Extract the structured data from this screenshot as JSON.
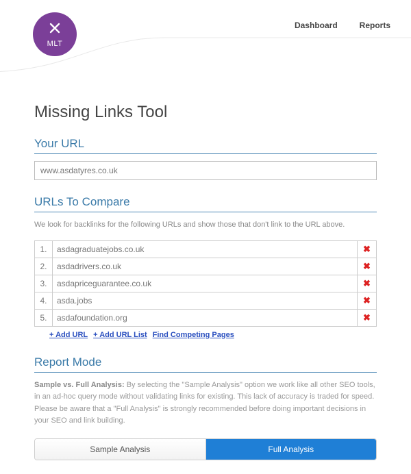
{
  "logo": {
    "text": "MLT"
  },
  "nav": {
    "dashboard": "Dashboard",
    "reports": "Reports"
  },
  "page": {
    "title": "Missing Links Tool"
  },
  "your_url": {
    "heading": "Your URL",
    "value": "www.asdatyres.co.uk"
  },
  "compare": {
    "heading": "URLs To Compare",
    "desc": "We look for backlinks for the following URLs and show those that don't link to the URL above.",
    "items": [
      {
        "n": "1.",
        "v": "asdagraduatejobs.co.uk"
      },
      {
        "n": "2.",
        "v": "asdadrivers.co.uk"
      },
      {
        "n": "3.",
        "v": "asdapriceguarantee.co.uk"
      },
      {
        "n": "4.",
        "v": "asda.jobs"
      },
      {
        "n": "5.",
        "v": "asdafoundation.org"
      }
    ],
    "add_url": "+ Add URL",
    "add_list": "+ Add URL List",
    "find": "Find Competing Pages"
  },
  "report": {
    "heading": "Report Mode",
    "desc_bold": "Sample vs. Full Analysis:",
    "desc_rest": " By selecting the \"Sample Analysis\" option we work like all other SEO tools, in an ad-hoc query mode without validating links for existing. This lack of accuracy is traded for speed. Please be aware that a \"Full Analysis\" is strongly recommended before doing important decisions in your SEO and link building.",
    "sample": "Sample Analysis",
    "full": "Full Analysis"
  }
}
